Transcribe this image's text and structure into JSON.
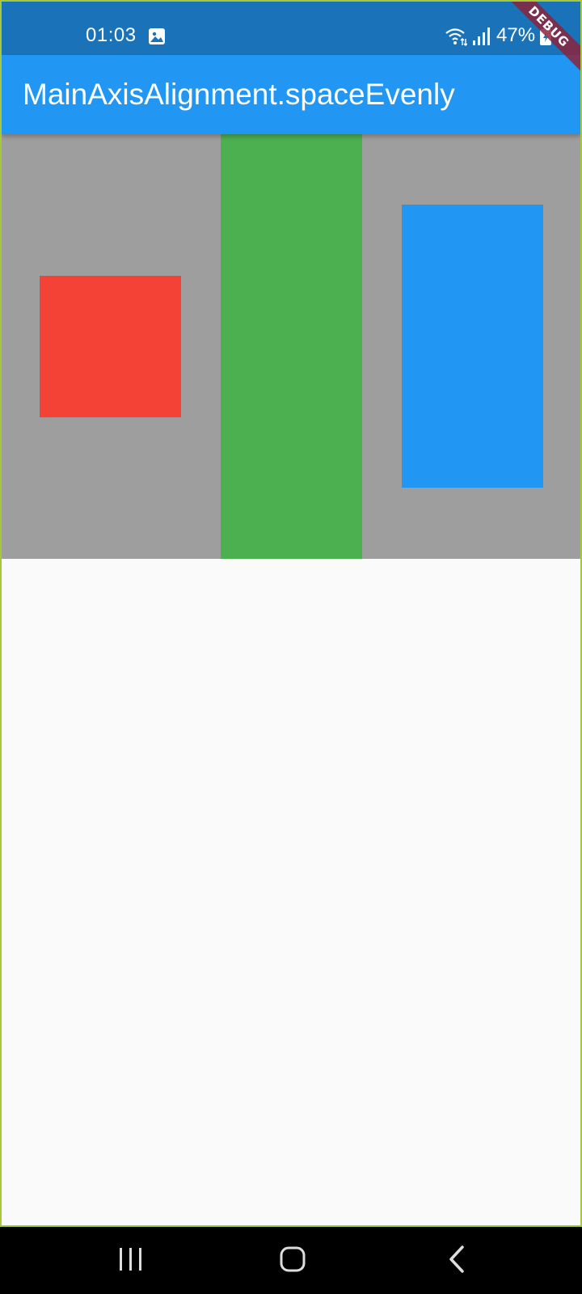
{
  "status_bar": {
    "time": "01:03",
    "battery": "47%",
    "icons": [
      "gallery-icon",
      "wifi-icon",
      "signal-icon",
      "battery-icon"
    ]
  },
  "debug_banner": "DEBUG",
  "app_bar": {
    "title": "MainAxisAlignment.spaceEvenly"
  },
  "colors": {
    "status_bar": "#1a73b9",
    "app_bar": "#2196f3",
    "row_background": "#9e9e9e",
    "red_box": "#f44336",
    "green_box": "#4caf50",
    "blue_box": "#2196f3",
    "page_background": "#fafafa"
  },
  "nav_bar": {
    "icons": [
      "recents-icon",
      "home-icon",
      "back-icon"
    ]
  }
}
